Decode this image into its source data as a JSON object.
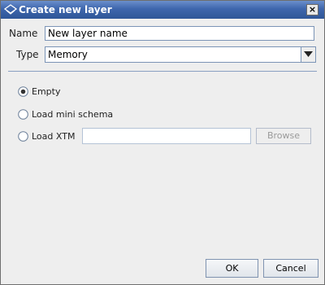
{
  "window": {
    "title": "Create new layer",
    "close_glyph": "×"
  },
  "form": {
    "name_label": "Name",
    "name_value": "New layer name",
    "type_label": "Type",
    "type_value": "Memory"
  },
  "options": [
    {
      "label": "Empty",
      "selected": true
    },
    {
      "label": "Load mini schema",
      "selected": false
    },
    {
      "label": "Load XTM",
      "selected": false
    }
  ],
  "xtm_field": {
    "value": ""
  },
  "buttons": {
    "browse": "Browse",
    "ok": "OK",
    "cancel": "Cancel"
  },
  "colors": {
    "titlebar": "#3e66ad",
    "border_accent": "#7b94b6",
    "background": "#eeeeee"
  }
}
